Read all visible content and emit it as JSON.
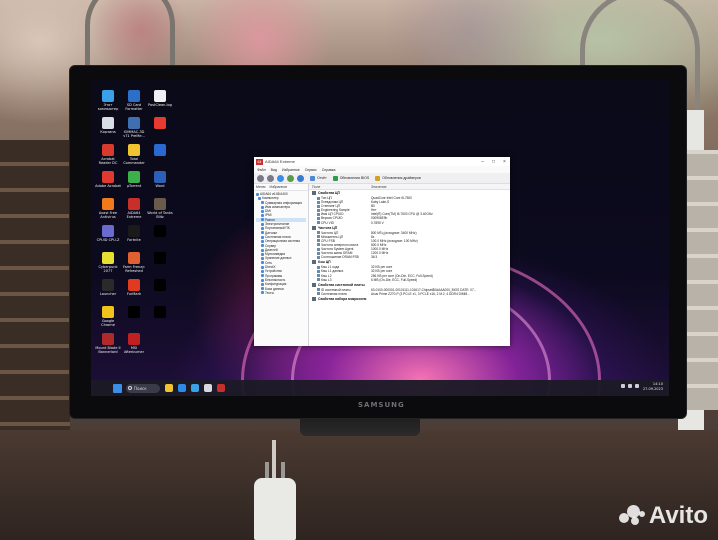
{
  "desktop": {
    "icons": [
      {
        "label": "Этот компьютер",
        "color": "#3aa0e8"
      },
      {
        "label": "SD Card Formatter",
        "color": "#2c6fc9"
      },
      {
        "label": "PostClean.log",
        "color": "#f0f0f0"
      },
      {
        "label": "Корзина",
        "color": "#d7dee6"
      },
      {
        "label": "IOMMAC-3D ч71 PreMe...",
        "color": "#3e6fb0"
      },
      {
        "label": "",
        "color": "#e83a2e"
      },
      {
        "label": "Acrobat Reader DC",
        "color": "#d93a2e"
      },
      {
        "label": "Total Commander",
        "color": "#f0c430"
      },
      {
        "label": "",
        "color": "#2a6ad0"
      },
      {
        "label": "Adobe Acrobat",
        "color": "#e03a30"
      },
      {
        "label": "µTorrent",
        "color": "#3cb04a"
      },
      {
        "label": "Word",
        "color": "#2b5fb8"
      },
      {
        "label": "Avast Free Antivirus",
        "color": "#ef7b1c"
      },
      {
        "label": "AIDA64 Extreme",
        "color": "#c7302a"
      },
      {
        "label": "World of Tanks Blitz",
        "color": "#6a5a4a"
      },
      {
        "label": "CPUID CPU-Z",
        "color": "#6a6ad0"
      },
      {
        "label": "Fortnite",
        "color": "#1a1a1a"
      },
      {
        "label": "",
        "color": "#000000"
      },
      {
        "label": "Cyberpunk 2077",
        "color": "#e8e030"
      },
      {
        "label": "Farm Frenzy: Refreshed",
        "color": "#e06030"
      },
      {
        "label": "",
        "color": "#000000"
      },
      {
        "label": "Launcher",
        "color": "#2a2a2a"
      },
      {
        "label": "FurMark",
        "color": "#e03a20"
      },
      {
        "label": "",
        "color": "#000000"
      },
      {
        "label": "Google Chrome",
        "color": "#f2c21c"
      },
      {
        "label": "",
        "color": "#000000"
      },
      {
        "label": "",
        "color": "#000000"
      },
      {
        "label": "Mount Blade II Bannerlord",
        "color": "#b02a2a"
      },
      {
        "label": "MSI Afterburner",
        "color": "#c02020"
      }
    ]
  },
  "taskbar": {
    "search_label": "Поиск",
    "apps": [
      "#f0c430",
      "#2c8ae8",
      "#3aa0e8",
      "#d8d8e0",
      "#c7302a"
    ],
    "time": "14:10",
    "date": "27.09.2023"
  },
  "window": {
    "title": "AIDA64 Extreme",
    "logo": "64",
    "menu": [
      "Файл",
      "Вид",
      "Избранное",
      "Сервис",
      "Справка"
    ],
    "toolbar": {
      "report": "Отчёт",
      "bios": "Обновления BIOS",
      "drivers": "Обновления драйверов"
    },
    "tabs": [
      "Меню",
      "Избранное"
    ],
    "tree": [
      "AIDA64 v6.88.6400",
      "Компьютер",
      "Суммарная информация",
      "Имя компьютера",
      "DMI",
      "IPMI",
      "Разгон",
      "Электропитание",
      "Портативный ПК",
      "Датчики",
      "Системная плата",
      "Операционная система",
      "Сервер",
      "Дисплей",
      "Мультимедиа",
      "Хранение данных",
      "Сеть",
      "DirectX",
      "Устройства",
      "Программы",
      "Безопасность",
      "Конфигурация",
      "База данных",
      "Тесты"
    ],
    "selected_tree_index": 6,
    "col_field": "Поле",
    "col_value": "Значение",
    "groups": [
      {
        "name": "Свойства ЦП",
        "rows": [
          [
            "Тип ЦП",
            "QuadCore Intel Core i5-7500"
          ],
          [
            "Псевдоним ЦП",
            "Kaby Lake-S"
          ],
          [
            "Степпинг ЦП",
            "B0"
          ],
          [
            "Engineering Sample",
            "Нет"
          ],
          [
            "Имя ЦП CPUID",
            "Intel(R) Core(TM) i5-7500 CPU @ 3.40GHz"
          ],
          [
            "Версия CPUID",
            "000906E9h"
          ],
          [
            "CPU VID",
            "0.7895 V"
          ]
        ]
      },
      {
        "name": "Частота ЦП",
        "rows": [
          [
            "Частота ЦП",
            "800 МГц (исходное: 3400 MHz)"
          ],
          [
            "Множитель ЦП",
            "8x"
          ],
          [
            "CPU FSB",
            "100.0 MHz (исходное: 100 MHz)"
          ],
          [
            "Частота северного моста",
            "800.0 MHz"
          ],
          [
            "Частота System Agent",
            "1000.0 MHz"
          ],
          [
            "Частота шины DRAM",
            "1200.0 MHz"
          ],
          [
            "Соотношение DRAM:FSB",
            "36:3"
          ]
        ]
      },
      {
        "name": "Кэш ЦП",
        "rows": [
          [
            "Кэш L1 кода",
            "32 KB per core"
          ],
          [
            "Кэш L1 данных",
            "32 KB per core"
          ],
          [
            "Кэш L2",
            "256 KB per core (On-Die, ECC, Full-Speed)"
          ],
          [
            "Кэш L3",
            "6 MB (On-Die, ECC, Full-Speed)"
          ]
        ]
      },
      {
        "name": "Свойства системной платы",
        "rows": [
          [
            "ID системной платы",
            "63-0100-000001-00101111-101617-Chipset$0AAAA000_BIOS DATE: 07..."
          ],
          [
            "Системная плата",
            "Asus Prime Z270-P  (3 PCI-E x1, 3 PCI-E x16, 2 M.2, 4 DDR4 DIMM..."
          ]
        ]
      }
    ],
    "footer_group": "Свойства набора микросхем"
  },
  "monitor": {
    "brand": "SAMSUNG"
  },
  "watermark": {
    "text": "Avito"
  }
}
